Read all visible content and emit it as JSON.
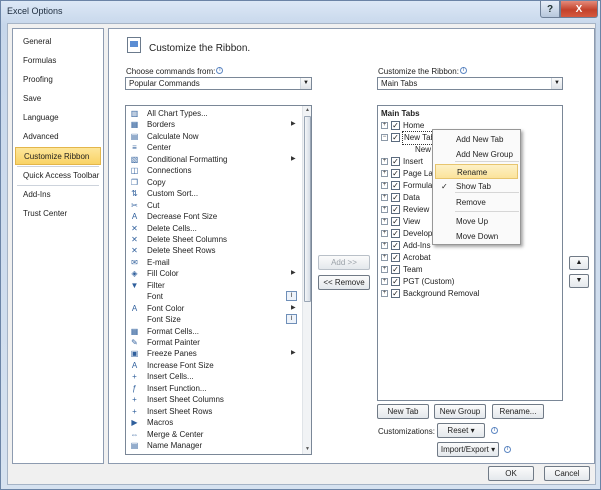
{
  "window": {
    "title": "Excel Options",
    "help_glyph": "?",
    "close_glyph": "X"
  },
  "nav": {
    "items": [
      {
        "label": "General"
      },
      {
        "label": "Formulas"
      },
      {
        "label": "Proofing"
      },
      {
        "label": "Save"
      },
      {
        "label": "Language"
      },
      {
        "label": "Advanced"
      },
      {
        "label": "Customize Ribbon"
      },
      {
        "label": "Quick Access Toolbar"
      },
      {
        "label": "Add-Ins"
      },
      {
        "label": "Trust Center"
      }
    ],
    "selected": "Customize Ribbon"
  },
  "header": {
    "title": "Customize the Ribbon."
  },
  "left_panel": {
    "label": "Choose commands from:",
    "combo_value": "Popular Commands",
    "commands": [
      {
        "label": "All Chart Types...",
        "icon": "chart-icon",
        "glyph": "▥"
      },
      {
        "label": "Borders",
        "icon": "borders-icon",
        "glyph": "▦",
        "submenu": true
      },
      {
        "label": "Calculate Now",
        "icon": "calculator-icon",
        "glyph": "▤"
      },
      {
        "label": "Center",
        "icon": "align-center-icon",
        "glyph": "≡"
      },
      {
        "label": "Conditional Formatting",
        "icon": "conditional-formatting-icon",
        "glyph": "▧",
        "submenu": true
      },
      {
        "label": "Connections",
        "icon": "connections-icon",
        "glyph": "◫"
      },
      {
        "label": "Copy",
        "icon": "copy-icon",
        "glyph": "❐"
      },
      {
        "label": "Custom Sort...",
        "icon": "sort-icon",
        "glyph": "⇅"
      },
      {
        "label": "Cut",
        "icon": "scissors-icon",
        "glyph": "✂"
      },
      {
        "label": "Decrease Font Size",
        "icon": "decrease-font-icon",
        "glyph": "A"
      },
      {
        "label": "Delete Cells...",
        "icon": "delete-cells-icon",
        "glyph": "✕"
      },
      {
        "label": "Delete Sheet Columns",
        "icon": "delete-columns-icon",
        "glyph": "✕"
      },
      {
        "label": "Delete Sheet Rows",
        "icon": "delete-rows-icon",
        "glyph": "✕"
      },
      {
        "label": "E-mail",
        "icon": "email-icon",
        "glyph": "✉"
      },
      {
        "label": "Fill Color",
        "icon": "fill-color-icon",
        "glyph": "◈",
        "submenu": true
      },
      {
        "label": "Filter",
        "icon": "filter-icon",
        "glyph": "▼"
      },
      {
        "label": "Font",
        "icon": "",
        "glyph": "",
        "field": true
      },
      {
        "label": "Font Color",
        "icon": "font-color-icon",
        "glyph": "A",
        "submenu": true
      },
      {
        "label": "Font Size",
        "icon": "",
        "glyph": "",
        "field": true
      },
      {
        "label": "Format Cells...",
        "icon": "format-cells-icon",
        "glyph": "▦"
      },
      {
        "label": "Format Painter",
        "icon": "format-painter-icon",
        "glyph": "✎"
      },
      {
        "label": "Freeze Panes",
        "icon": "freeze-panes-icon",
        "glyph": "▣",
        "submenu": true
      },
      {
        "label": "Increase Font Size",
        "icon": "increase-font-icon",
        "glyph": "A"
      },
      {
        "label": "Insert Cells...",
        "icon": "insert-cells-icon",
        "glyph": "+"
      },
      {
        "label": "Insert Function...",
        "icon": "function-icon",
        "glyph": "ƒ"
      },
      {
        "label": "Insert Sheet Columns",
        "icon": "insert-columns-icon",
        "glyph": "+"
      },
      {
        "label": "Insert Sheet Rows",
        "icon": "insert-rows-icon",
        "glyph": "+"
      },
      {
        "label": "Macros",
        "icon": "macros-icon",
        "glyph": "▶"
      },
      {
        "label": "Merge & Center",
        "icon": "merge-center-icon",
        "glyph": "⇔"
      },
      {
        "label": "Name Manager",
        "icon": "name-manager-icon",
        "glyph": "▤"
      },
      {
        "label": "New",
        "icon": "new-icon",
        "glyph": "▯"
      }
    ]
  },
  "mid_buttons": {
    "add": "Add >>",
    "remove": "<< Remove"
  },
  "right_panel": {
    "label": "Customize the Ribbon:",
    "combo_value": "Main Tabs",
    "tree_header": "Main Tabs",
    "tree": [
      {
        "label": "Home",
        "expander": "+",
        "checked": true
      },
      {
        "label": "New Tab (Custom)",
        "expander": "−",
        "checked": true
      },
      {
        "label": "New Group (Custom)",
        "child": true
      },
      {
        "label": "Insert",
        "expander": "+",
        "checked": true
      },
      {
        "label": "Page Layout",
        "expander": "+",
        "checked": true
      },
      {
        "label": "Formulas",
        "expander": "+",
        "checked": true
      },
      {
        "label": "Data",
        "expander": "+",
        "checked": true
      },
      {
        "label": "Review",
        "expander": "+",
        "checked": true
      },
      {
        "label": "View",
        "expander": "+",
        "checked": true
      },
      {
        "label": "Developer",
        "expander": "+",
        "checked": true
      },
      {
        "label": "Add-Ins",
        "expander": "+",
        "checked": true
      },
      {
        "label": "Acrobat",
        "expander": "+",
        "checked": true
      },
      {
        "label": "Team",
        "expander": "+",
        "checked": true
      },
      {
        "label": "PGT (Custom)",
        "expander": "+",
        "checked": true
      },
      {
        "label": "Background Removal",
        "expander": "+",
        "checked": true
      }
    ],
    "new_tab": "New Tab",
    "new_group": "New Group",
    "rename": "Rename...",
    "customizations_label": "Customizations:",
    "reset": "Reset",
    "import_export": "Import/Export"
  },
  "context_menu": {
    "items": [
      {
        "label": "Add New Tab"
      },
      {
        "label": "Add New Group"
      },
      {
        "label": "Rename",
        "highlighted": true
      },
      {
        "label": "Show Tab",
        "checked": true
      },
      {
        "label": "Remove"
      },
      {
        "label": "Move Up"
      },
      {
        "label": "Move Down"
      }
    ]
  },
  "footer": {
    "ok": "OK",
    "cancel": "Cancel"
  }
}
